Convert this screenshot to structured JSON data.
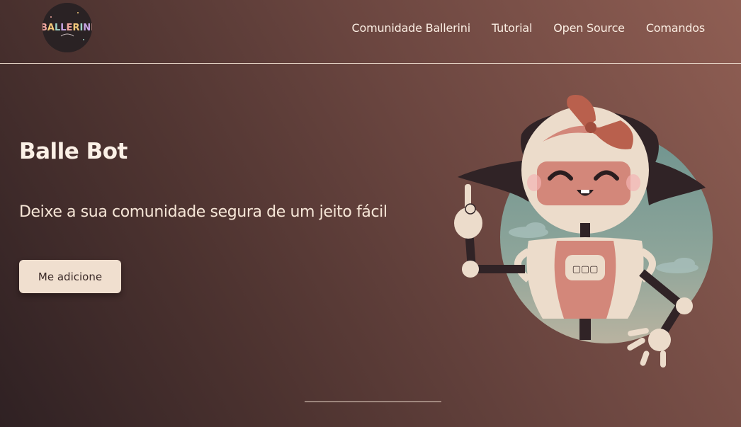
{
  "logo": {
    "text": "BALLERINI",
    "letter_colors": [
      "#f2a7a0",
      "#f4c97a",
      "#9fd3c7",
      "#c9a7e8",
      "#f2a7a0",
      "#f4c97a",
      "#9fd3c7",
      "#c9a7e8",
      "#f2a7a0"
    ]
  },
  "nav": {
    "items": [
      {
        "label": "Comunidade Ballerini"
      },
      {
        "label": "Tutorial"
      },
      {
        "label": "Open Source"
      },
      {
        "label": "Comandos"
      }
    ]
  },
  "hero": {
    "title": "Balle Bot",
    "subtitle": "Deixe a sua comunidade segura de um jeito fácil",
    "cta_label": "Me adicione"
  },
  "robot": {
    "chest_label": "▢▢▢"
  },
  "colors": {
    "bg_dark": "#2f2123",
    "bg_light": "#8f5e53",
    "text": "#fbf0e6",
    "button_bg": "#f0dfcf",
    "robot_face": "#d3877a",
    "robot_body": "#ecdccb",
    "robot_hair": "#302326",
    "circle_sky": "#7a9a94"
  }
}
